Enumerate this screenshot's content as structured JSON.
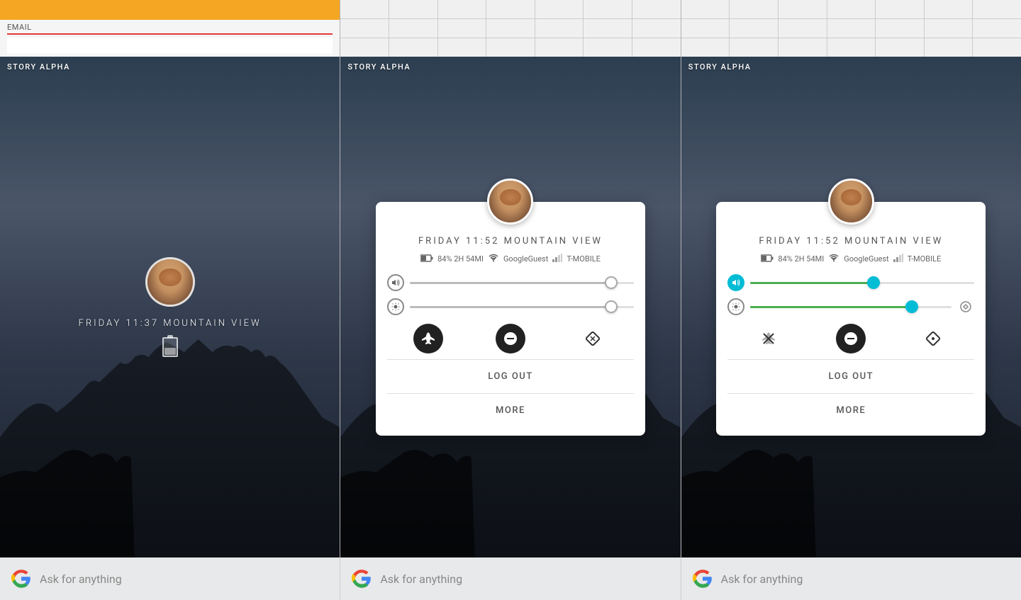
{
  "panels": [
    {
      "id": "panel-1",
      "type": "locked",
      "top_label": "EMAIL",
      "story_alpha": "STORY ALPHA",
      "time": "FRIDAY 11:37 MOUNTAIN VIEW",
      "show_qs": false
    },
    {
      "id": "panel-2",
      "type": "qs",
      "story_alpha": "STORY ALPHA",
      "time": "FRIDAY 11:52 MOUNTAIN VIEW",
      "battery": "84% 2H 54MI",
      "wifi": "GoogleGuest",
      "carrier": "T-MOBILE",
      "vol_level": 0.9,
      "bri_level": 0.9,
      "airplane": false,
      "dnd": true,
      "rotate": true,
      "logout_label": "LOG OUT",
      "more_label": "MORE",
      "show_qs": true,
      "slider_style": "gray"
    },
    {
      "id": "panel-3",
      "type": "qs",
      "story_alpha": "STORY ALPHA",
      "time": "FRIDAY 11:52 MOUNTAIN VIEW",
      "battery": "84% 2H 54MI",
      "wifi": "GoogleGuest",
      "carrier": "T-MOBILE",
      "vol_level": 0.55,
      "bri_level": 0.8,
      "airplane": true,
      "dnd": true,
      "rotate": true,
      "logout_label": "LOG OUT",
      "more_label": "MORE",
      "show_qs": true,
      "slider_style": "green"
    }
  ],
  "bottom_bar": {
    "ask_placeholder": "Ask for anything"
  }
}
